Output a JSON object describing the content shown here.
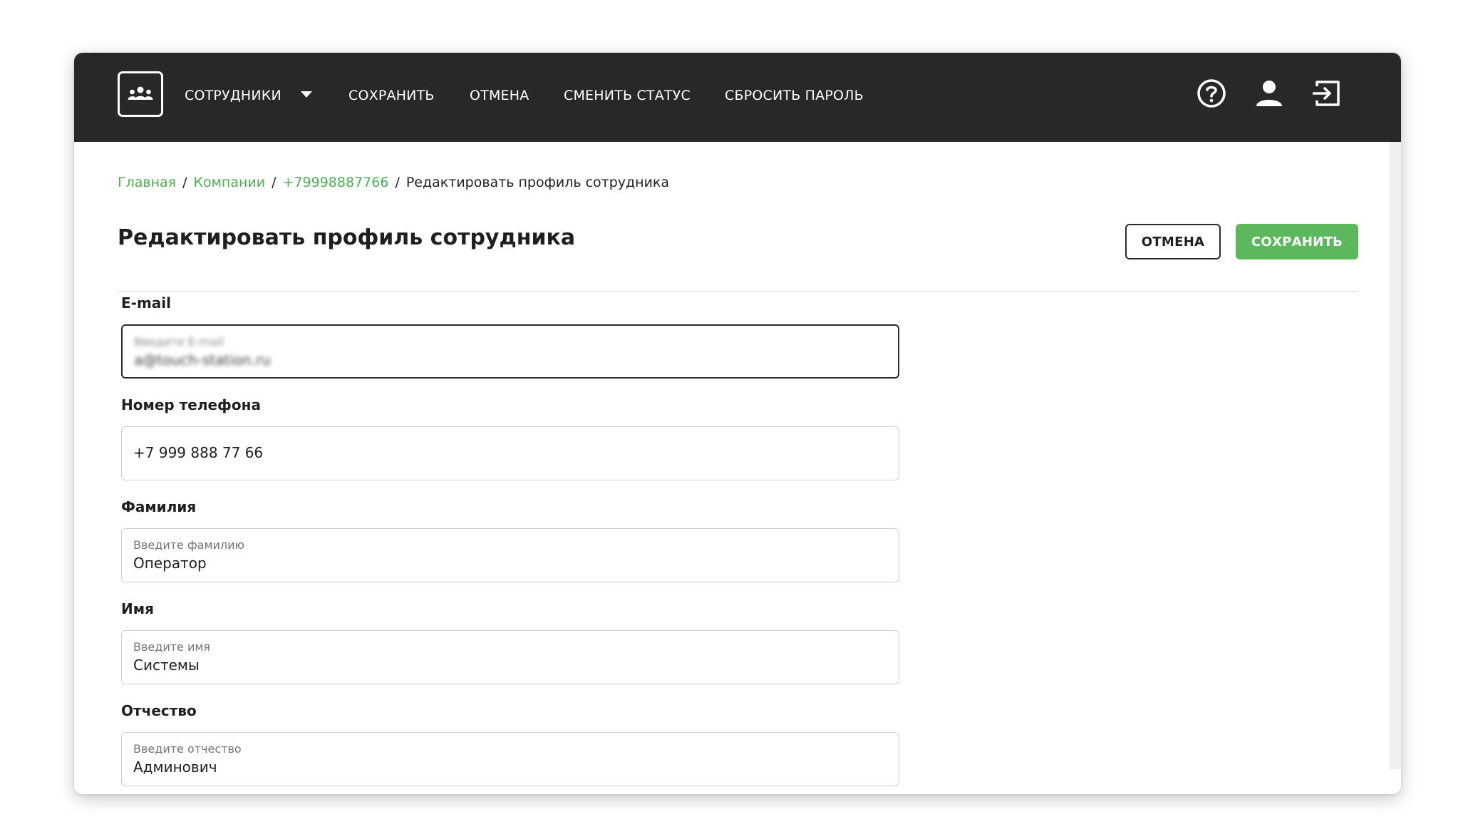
{
  "nav": {
    "employees": "СОТРУДНИКИ",
    "save": "СОХРАНИТЬ",
    "cancel": "ОТМЕНА",
    "change_status": "СМЕНИТЬ СТАТУС",
    "reset_password": "СБРОСИТЬ ПАРОЛЬ"
  },
  "icons": {
    "logo": "team-icon",
    "help": "help-icon",
    "profile": "user-icon",
    "logout": "logout-icon"
  },
  "breadcrumb": {
    "home": "Главная",
    "companies": "Компании",
    "phone": "+79998887766",
    "current": "Редактировать профиль сотрудника",
    "separator": "/"
  },
  "page": {
    "title": "Редактировать профиль сотрудника",
    "cancel_label": "ОТМЕНА",
    "save_label": "СОХРАНИТЬ"
  },
  "form": {
    "email": {
      "label": "E-mail",
      "placeholder": "Введите E-mail",
      "value": "a@touch-station.ru"
    },
    "phone": {
      "label": "Номер телефона",
      "value": "+7 999 888 77 66"
    },
    "last_name": {
      "label": "Фамилия",
      "placeholder": "Введите фамилию",
      "value": "Оператор"
    },
    "first_name": {
      "label": "Имя",
      "placeholder": "Введите имя",
      "value": "Системы"
    },
    "middle_name": {
      "label": "Отчество",
      "placeholder": "Введите отчество",
      "value": "Админович"
    }
  },
  "colors": {
    "topbar": "#282828",
    "accent": "#5cb85c",
    "link": "#4caf50"
  }
}
